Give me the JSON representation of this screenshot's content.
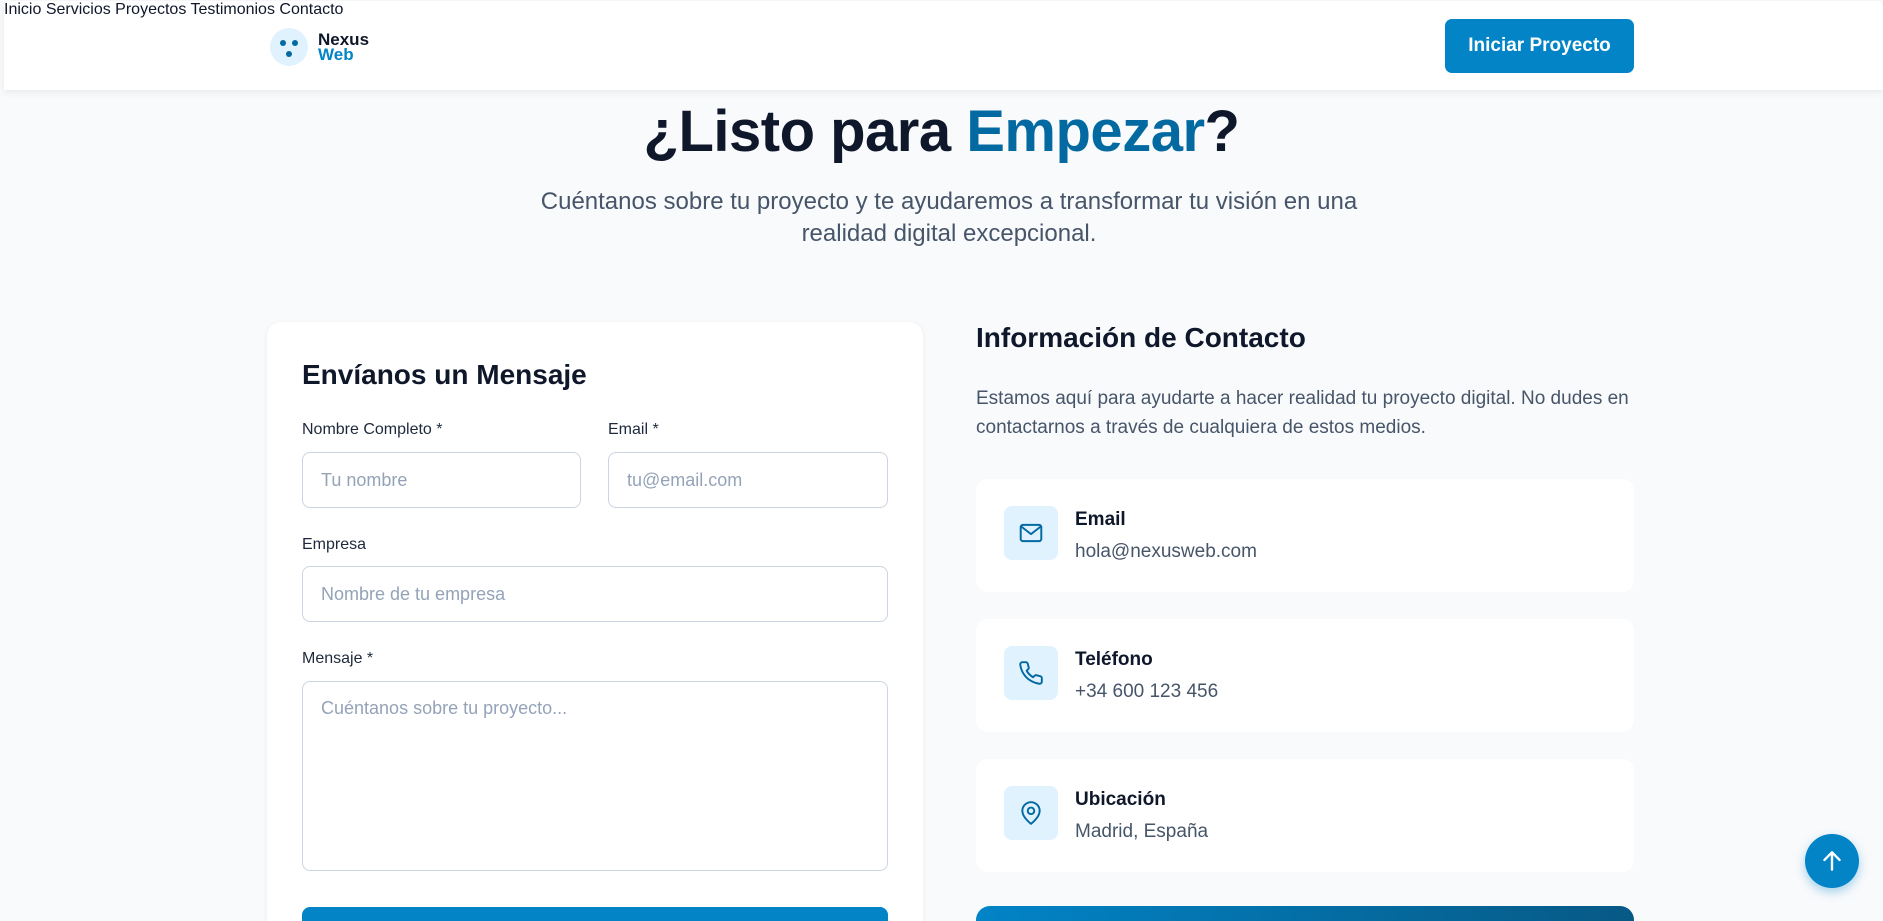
{
  "header": {
    "logo": {
      "line1": "Nexus",
      "line2": "Web",
      "icon": "logo-dots-icon"
    },
    "nav": [
      "Inicio",
      "Servicios",
      "Proyectos",
      "Testimonios",
      "Contacto"
    ],
    "cta_label": "Iniciar Proyecto"
  },
  "hero": {
    "title_start": "¿Listo para ",
    "title_accent": "Empezar",
    "title_end": "?",
    "subtitle": "Cuéntanos sobre tu proyecto y te ayudaremos a transformar tu visión en una realidad digital excepcional."
  },
  "form": {
    "title": "Envíanos un Mensaje",
    "name_label": "Nombre Completo *",
    "name_placeholder": "Tu nombre",
    "email_label": "Email *",
    "email_placeholder": "tu@email.com",
    "company_label": "Empresa",
    "company_placeholder": "Nombre de tu empresa",
    "message_label": "Mensaje *",
    "message_placeholder": "Cuéntanos sobre tu proyecto..."
  },
  "contact": {
    "title": "Información de Contacto",
    "description": "Estamos aquí para ayudarte a hacer realidad tu proyecto digital. No dudes en contactarnos a través de cualquiera de estos medios.",
    "items": [
      {
        "label": "Email",
        "value": "hola@nexusweb.com",
        "icon": "mail-icon"
      },
      {
        "label": "Teléfono",
        "value": "+34 600 123 456",
        "icon": "phone-icon"
      },
      {
        "label": "Ubicación",
        "value": "Madrid, España",
        "icon": "map-pin-icon"
      }
    ]
  },
  "colors": {
    "brand": "#0284c7",
    "accent_text": "#0369a1",
    "background": "#f8fafc"
  },
  "scroll_top_icon": "arrow-up-icon"
}
